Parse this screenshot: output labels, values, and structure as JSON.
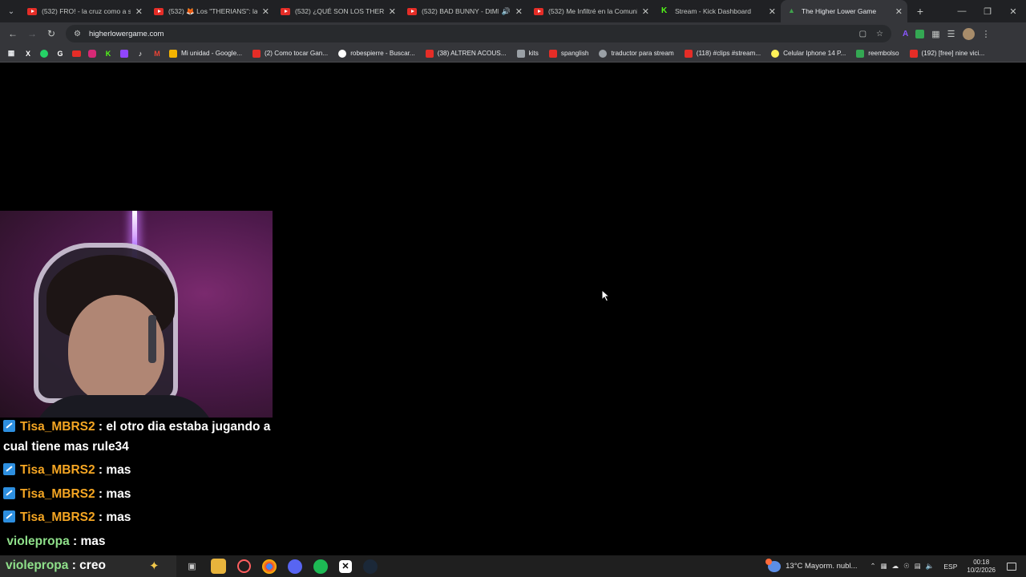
{
  "browser": {
    "tabs": [
      {
        "label": "(532) FRO! - la cruz como a sa",
        "favicon": "youtube-icon",
        "active": false
      },
      {
        "label": "(532) 🦊 Los \"THERIANS\": la co",
        "favicon": "youtube-icon",
        "active": false
      },
      {
        "label": "(532) ¿QUÉ SON LOS THERIAN",
        "favicon": "youtube-icon",
        "active": false
      },
      {
        "label": "(532) BAD BUNNY - DtMF (",
        "favicon": "youtube-icon",
        "active": false,
        "audio": true
      },
      {
        "label": "(532) Me Infiltré en la Comunid",
        "favicon": "youtube-icon",
        "active": false
      },
      {
        "label": "Stream - Kick Dashboard",
        "favicon": "kick-icon",
        "active": false
      },
      {
        "label": "The Higher Lower Game",
        "favicon": "higherlower-icon",
        "active": true
      }
    ],
    "url": "higherlowergame.com",
    "bookmarks": [
      {
        "label": "Mi unidad - Google...",
        "icon_color": "#f4b400"
      },
      {
        "label": "(2) Como tocar Gan...",
        "icon_color": "#e52d27"
      },
      {
        "label": "robespierre - Buscar...",
        "icon_color": "#ffffff"
      },
      {
        "label": "(38) ALTREN ACOUS...",
        "icon_color": "#e52d27"
      },
      {
        "label": "kits",
        "icon_color": "#9aa0a6"
      },
      {
        "label": "spanglish",
        "icon_color": "#e52d27"
      },
      {
        "label": "traductor para stream",
        "icon_color": "#9aa0a6"
      },
      {
        "label": "(118) #clips #stream...",
        "icon_color": "#e52d27"
      },
      {
        "label": "Celular Iphone 14 P...",
        "icon_color": "#fff159"
      },
      {
        "label": "reembolso",
        "icon_color": "#34a853"
      },
      {
        "label": "(192) [free] nine vici...",
        "icon_color": "#e52d27"
      }
    ]
  },
  "chat": {
    "messages": [
      {
        "user": "Tisa_MBRS2",
        "text": "el otro dia estaba jugando a cual tiene mas rule34",
        "badge": true,
        "color": "#f5a623"
      },
      {
        "user": "Tisa_MBRS2",
        "text": "mas",
        "badge": true,
        "color": "#f5a623"
      },
      {
        "user": "Tisa_MBRS2",
        "text": "mas",
        "badge": true,
        "color": "#f5a623"
      },
      {
        "user": "Tisa_MBRS2",
        "text": "mas",
        "badge": true,
        "color": "#f5a623"
      },
      {
        "user": "violepropa",
        "text": "mas",
        "badge": false,
        "color": "#8fe08a"
      },
      {
        "user": "violepropa",
        "text": "creo",
        "badge": false,
        "color": "#8fe08a"
      }
    ]
  },
  "taskbar": {
    "weather": "13°C  Mayorm. nubl...",
    "language": "ESP",
    "time": "00:18",
    "date": "10/2/2026"
  }
}
